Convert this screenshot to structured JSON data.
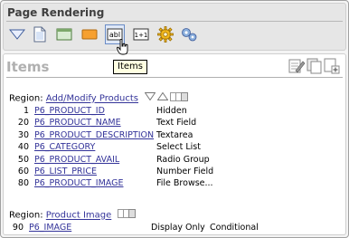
{
  "header": {
    "title": "Page Rendering",
    "toolbar": [
      {
        "icon": "triangle-down-icon"
      },
      {
        "icon": "page-icon"
      },
      {
        "icon": "region-icon"
      },
      {
        "icon": "button-icon"
      },
      {
        "icon": "text-item-icon",
        "label": "abl",
        "selected": true
      },
      {
        "icon": "computation-icon",
        "label": "1+1"
      },
      {
        "icon": "gear-icon"
      },
      {
        "icon": "shared-components-icon"
      }
    ]
  },
  "tooltip": "Items",
  "panel": {
    "title": "Items",
    "regions": [
      {
        "label": "Region:",
        "name": "Add/Modify Products",
        "items": [
          {
            "seq": "1",
            "name": "P6_PRODUCT_ID",
            "type": "Hidden",
            "cond": ""
          },
          {
            "seq": "20",
            "name": "P6_PRODUCT_NAME",
            "type": "Text Field",
            "cond": ""
          },
          {
            "seq": "30",
            "name": "P6_PRODUCT_DESCRIPTION",
            "type": "Textarea",
            "cond": ""
          },
          {
            "seq": "40",
            "name": "P6_CATEGORY",
            "type": "Select List",
            "cond": ""
          },
          {
            "seq": "50",
            "name": "P6_PRODUCT_AVAIL",
            "type": "Radio Group",
            "cond": ""
          },
          {
            "seq": "60",
            "name": "P6_LIST_PRICE",
            "type": "Number Field",
            "cond": ""
          },
          {
            "seq": "80",
            "name": "P6_PRODUCT_IMAGE",
            "type": "File Browse...",
            "cond": ""
          }
        ]
      },
      {
        "label": "Region:",
        "name": "Product Image",
        "items": [
          {
            "seq": "90",
            "name": "P6_IMAGE",
            "type": "Display Only",
            "cond": "Conditional"
          }
        ]
      }
    ]
  }
}
